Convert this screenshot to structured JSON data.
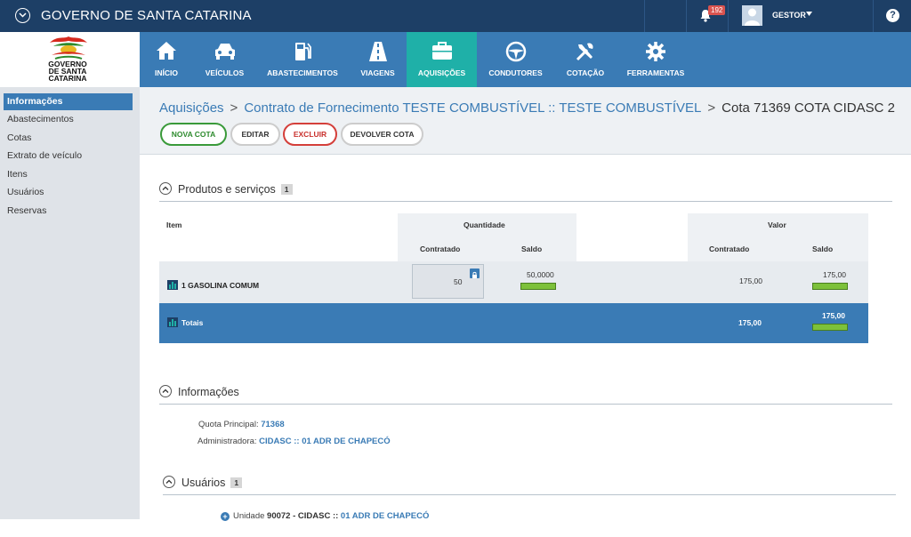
{
  "header": {
    "title": "GOVERNO DE SANTA CATARINA",
    "notifications_count": "192",
    "user": "GESTOR",
    "help": "?"
  },
  "logo": {
    "lines": [
      "GOVERNO",
      "DE SANTA",
      "CATARINA"
    ]
  },
  "nav": [
    {
      "label": "INÍCIO",
      "icon": "home-icon"
    },
    {
      "label": "VEÍCULOS",
      "icon": "car-icon"
    },
    {
      "label": "ABASTECIMENTOS",
      "icon": "fuel-pump-icon"
    },
    {
      "label": "VIAGENS",
      "icon": "road-icon"
    },
    {
      "label": "AQUISIÇÕES",
      "icon": "briefcase-icon",
      "active": true
    },
    {
      "label": "CONDUTORES",
      "icon": "steering-wheel-icon"
    },
    {
      "label": "COTAÇÃO",
      "icon": "tools-icon"
    },
    {
      "label": "FERRAMENTAS",
      "icon": "gear-icon"
    }
  ],
  "sidebar": {
    "items": [
      {
        "label": "Informações",
        "active": true
      },
      {
        "label": "Abastecimentos"
      },
      {
        "label": "Cotas"
      },
      {
        "label": "Extrato de veículo"
      },
      {
        "label": "Itens"
      },
      {
        "label": "Usuários"
      },
      {
        "label": "Reservas"
      }
    ]
  },
  "breadcrumb": {
    "root": "Aquisições",
    "contract": "Contrato de Fornecimento TESTE COMBUSTÍVEL :: TESTE COMBUSTÍVEL",
    "current": "Cota 71369 COTA CIDASC 2"
  },
  "actions": {
    "new": "NOVA COTA",
    "edit": "EDITAR",
    "delete": "EXCLUIR",
    "return": "DEVOLVER COTA"
  },
  "products": {
    "title": "Produtos e serviços",
    "count": "1",
    "headers": {
      "item": "Item",
      "quantity": "Quantidade",
      "value": "Valor",
      "contracted": "Contratado",
      "balance": "Saldo"
    },
    "rows": [
      {
        "item": "1 GASOLINA COMUM",
        "qty_contracted": "50",
        "qty_balance": "50,0000",
        "qty_balance_fraction": 1.0,
        "val_contracted": "175,00",
        "val_balance": "175,00",
        "val_balance_fraction": 1.0
      }
    ],
    "totals": {
      "label": "Totais",
      "val_contracted": "175,00",
      "val_balance": "175,00",
      "val_balance_fraction": 1.0
    }
  },
  "info": {
    "title": "Informações",
    "principal_label": "Quota Principal:",
    "principal_value": "71368",
    "admin_label": "Administradora:",
    "admin_value": "CIDASC :: 01 ADR DE CHAPECÓ"
  },
  "users": {
    "title": "Usuários",
    "count": "1",
    "unit_label": "Unidade",
    "unit_code": "90072 - CIDASC ::",
    "unit_name": "01 ADR DE CHAPECÓ"
  },
  "colors": {
    "topbar": "#1d3f66",
    "nav": "#3a7bb5",
    "nav_active": "#1fb0a8",
    "progress": "#7dc13a"
  }
}
